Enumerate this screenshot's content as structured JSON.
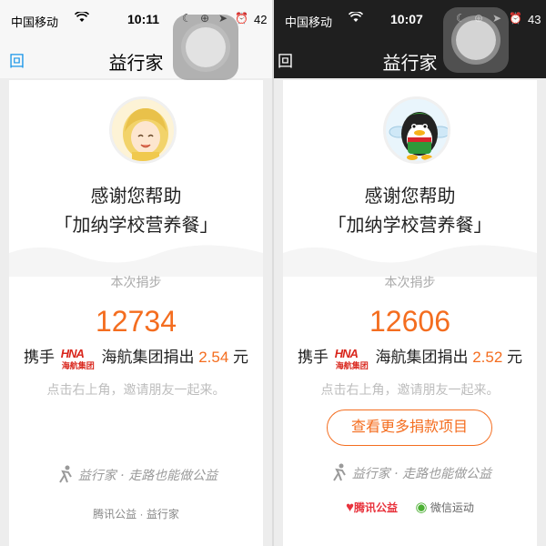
{
  "left": {
    "status": {
      "carrier": "中国移动",
      "wifi": "wifi-icon",
      "time": "10:11",
      "battery": "42"
    },
    "nav": {
      "title": "益行家",
      "back": "回"
    },
    "thanks_line1": "感谢您帮助",
    "thanks_line2": "「加纳学校营养餐」",
    "steps_label": "本次捐步",
    "steps": "12734",
    "sponsor_prefix": "携手",
    "hna_logo_text": "HNA",
    "hna_logo_sub": "海航集团",
    "sponsor_mid": "海航集团捐出",
    "amount": "2.54",
    "unit": "元",
    "hint": "点击右上角，邀请朋友一起来。",
    "slogan": "益行家 · 走路也能做公益",
    "footer": "腾讯公益 · 益行家"
  },
  "right": {
    "status": {
      "carrier": "中国移动",
      "wifi": "wifi-icon",
      "time": "10:07",
      "battery": "43"
    },
    "nav": {
      "title": "益行家",
      "back": "回"
    },
    "thanks_line1": "感谢您帮助",
    "thanks_line2": "「加纳学校营养餐」",
    "steps_label": "本次捐步",
    "steps": "12606",
    "sponsor_prefix": "携手",
    "hna_logo_text": "HNA",
    "hna_logo_sub": "海航集团",
    "sponsor_mid": "海航集团捐出",
    "amount": "2.52",
    "unit": "元",
    "hint": "点击右上角，邀请朋友一起来。",
    "more_button": "查看更多捐款项目",
    "slogan": "益行家 · 走路也能做公益",
    "footer_logo1": "腾讯公益",
    "footer_logo2": "微信运动"
  },
  "colors": {
    "accent": "#f46d1f",
    "link": "#1a96e8",
    "dark_bar": "#1f1f1f"
  }
}
